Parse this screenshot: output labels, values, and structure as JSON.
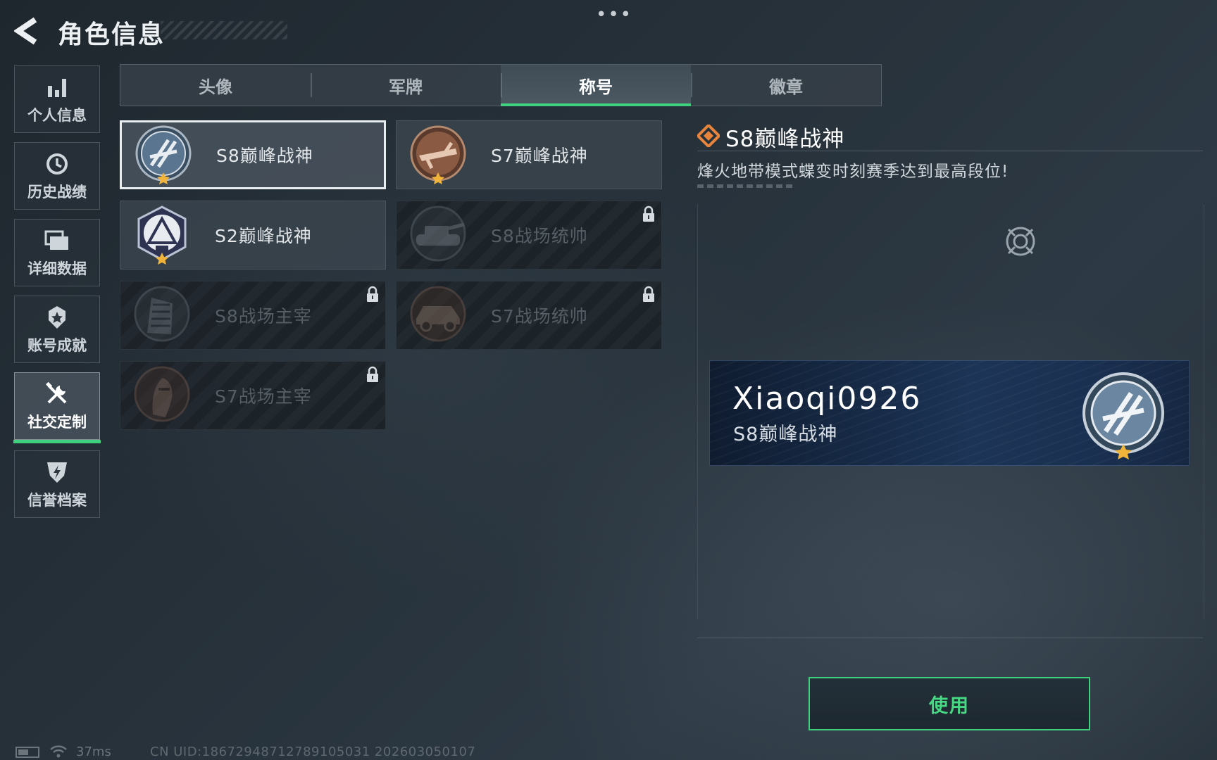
{
  "header": {
    "title": "角色信息"
  },
  "sidebar": {
    "items": [
      {
        "label": "个人信息",
        "icon": "bar-chart-icon",
        "active": false
      },
      {
        "label": "历史战绩",
        "icon": "history-clock-icon",
        "active": false
      },
      {
        "label": "详细数据",
        "icon": "folders-icon",
        "active": false
      },
      {
        "label": "账号成就",
        "icon": "medal-icon",
        "active": false
      },
      {
        "label": "社交定制",
        "icon": "tools-icon",
        "active": true
      },
      {
        "label": "信誉档案",
        "icon": "shield-icon",
        "active": false
      }
    ]
  },
  "tabs": [
    {
      "label": "头像",
      "active": false
    },
    {
      "label": "军牌",
      "active": false
    },
    {
      "label": "称号",
      "active": true
    },
    {
      "label": "徽章",
      "active": false
    }
  ],
  "titles": [
    {
      "name": "S8巅峰战神",
      "emblem": "s8-peak-emblem-icon",
      "locked": false,
      "selected": true
    },
    {
      "name": "S7巅峰战神",
      "emblem": "s7-peak-emblem-icon",
      "locked": false,
      "selected": false
    },
    {
      "name": "S2巅峰战神",
      "emblem": "s2-peak-emblem-icon",
      "locked": false,
      "selected": false
    },
    {
      "name": "S8战场统帅",
      "emblem": "tank-emblem-icon",
      "locked": true,
      "selected": false
    },
    {
      "name": "S8战场主宰",
      "emblem": "building-emblem-icon",
      "locked": true,
      "selected": false
    },
    {
      "name": "S7战场统帅",
      "emblem": "armored-vehicle-emblem-icon",
      "locked": true,
      "selected": false
    },
    {
      "name": "S7战场主宰",
      "emblem": "soldier-emblem-icon",
      "locked": true,
      "selected": false
    }
  ],
  "detail": {
    "title": "S8巅峰战神",
    "description": "烽火地带模式蝶变时刻赛季达到最高段位!"
  },
  "preview": {
    "player_name": "Xiaoqi0926",
    "title": "S8巅峰战神"
  },
  "use_button": {
    "label": "使用"
  },
  "status": {
    "ping": "37ms",
    "uid": "CN UID:18672948712789105031 202603050107"
  },
  "colors": {
    "accent_green": "#3fd07e",
    "diamond_orange": "#e8843c",
    "emblem_gold": "#f0b43a"
  }
}
